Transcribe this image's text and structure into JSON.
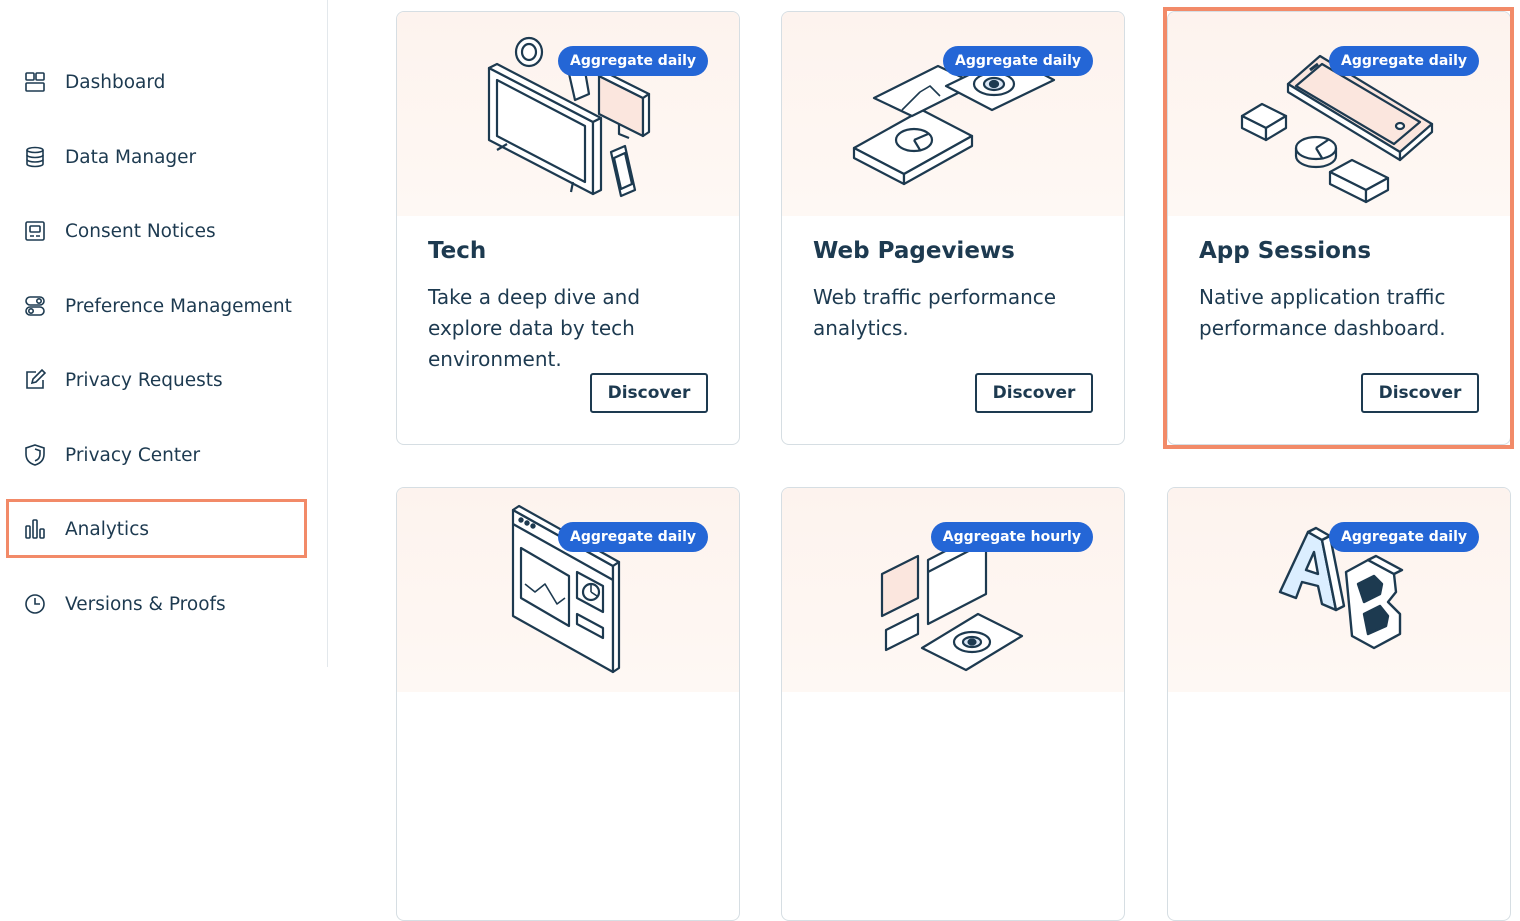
{
  "sidebar": {
    "items": [
      {
        "label": "Dashboard",
        "icon": "dashboard-icon"
      },
      {
        "label": "Data Manager",
        "icon": "database-icon"
      },
      {
        "label": "Consent Notices",
        "icon": "consent-notice-icon"
      },
      {
        "label": "Preference Management",
        "icon": "toggle-icon"
      },
      {
        "label": "Privacy Requests",
        "icon": "edit-request-icon"
      },
      {
        "label": "Privacy Center",
        "icon": "shield-icon"
      },
      {
        "label": "Analytics",
        "icon": "bar-chart-icon",
        "highlighted": true
      },
      {
        "label": "Versions & Proofs",
        "icon": "clock-icon"
      }
    ]
  },
  "cards": [
    {
      "title": "Tech",
      "description": "Take a deep dive and explore data by tech environment.",
      "badge": "Aggregate daily",
      "button": "Discover",
      "illustration": "devices-illustration"
    },
    {
      "title": "Web Pageviews",
      "description": "Web traffic performance analytics.",
      "badge": "Aggregate daily",
      "button": "Discover",
      "illustration": "web-pages-illustration"
    },
    {
      "title": "App Sessions",
      "description": "Native application traffic performance dashboard.",
      "badge": "Aggregate daily",
      "button": "Discover",
      "illustration": "phone-illustration",
      "highlighted": true
    },
    {
      "badge": "Aggregate daily",
      "illustration": "browser-charts-illustration"
    },
    {
      "badge": "Aggregate hourly",
      "illustration": "windows-eye-illustration"
    },
    {
      "badge": "Aggregate daily",
      "illustration": "ab-test-illustration"
    }
  ],
  "colors": {
    "accent": "#2466d6",
    "highlight": "#f28a68",
    "text": "#1d3a50",
    "art_background": "#fdf3ee"
  }
}
